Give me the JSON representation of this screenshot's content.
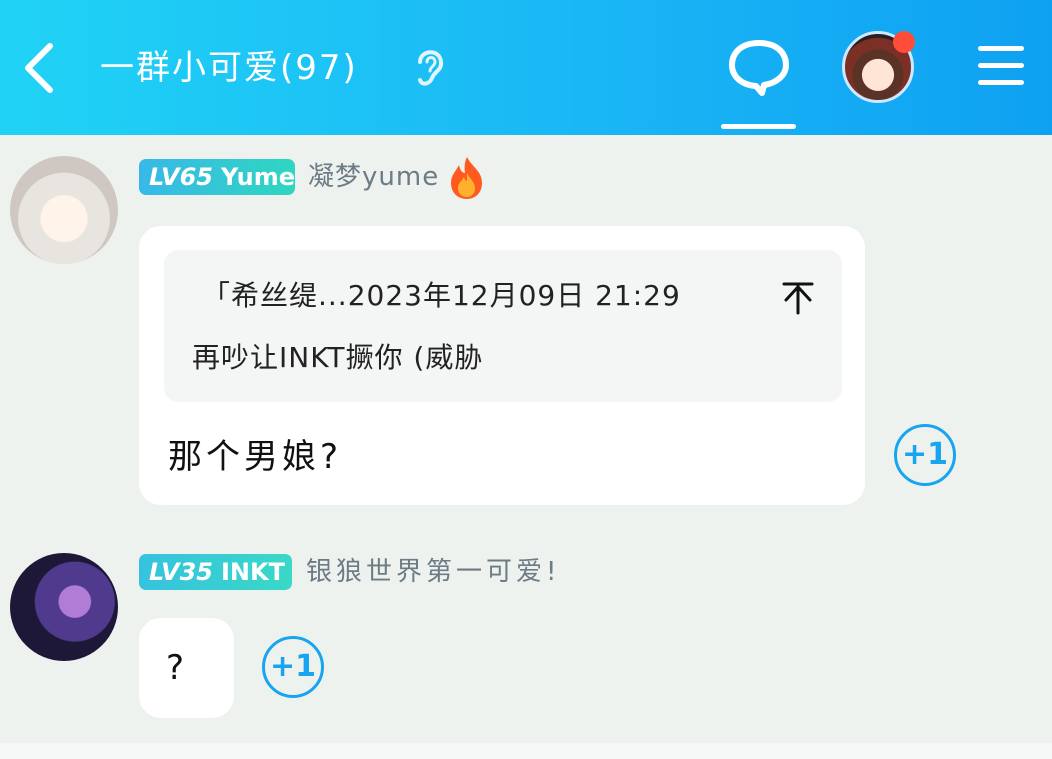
{
  "header": {
    "title": "一群小可爱(97)",
    "icons": {
      "back": "chevron-left-icon",
      "ear": "ear-icon",
      "chat": "chat-bubble-icon",
      "menu": "hamburger-menu-icon"
    },
    "notification_dot_color": "#ff4d3a",
    "gradient": [
      "#20d3f5",
      "#0ea1f2"
    ]
  },
  "messages": [
    {
      "level": "LV65",
      "badge_name": "Yume",
      "nickname": "凝梦yume",
      "flair_icon": "fire-icon",
      "quote": {
        "head": "「希丝缇...2023年12月09日 21:29",
        "body": "再吵让INKT撅你 (威胁"
      },
      "text": "那个男娘?",
      "plus_label": "+1"
    },
    {
      "level": "LV35",
      "badge_name": "INKT",
      "nickname": "银狼世界第一可爱!",
      "text": "?",
      "plus_label": "+1"
    }
  ],
  "colors": {
    "accent": "#17a4f0",
    "badge_teal": "#2fd6c0",
    "background": "#eef2ef"
  }
}
